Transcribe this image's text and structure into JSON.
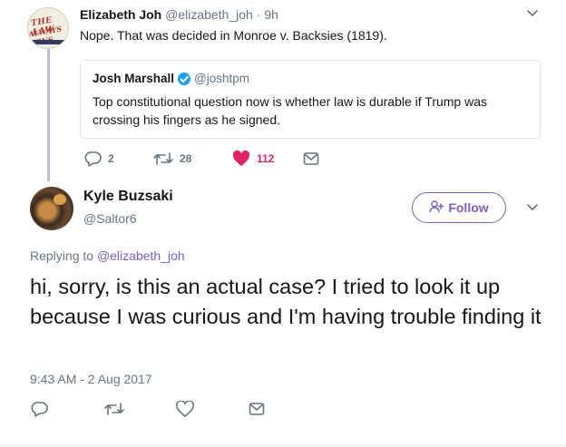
{
  "parent_tweet": {
    "avatar_text_line1": "THE LAW",
    "avatar_text_line2": "ALWAYS WINS",
    "author_name": "Elizabeth Joh",
    "author_handle": "@elizabeth_joh",
    "separator": "·",
    "time": "9h",
    "text": "Nope. That was decided in Monroe v. Backsies (1819).",
    "quoted": {
      "author_name": "Josh Marshall",
      "author_handle": "@joshtpm",
      "text": "Top constitutional question now is whether law is durable if Trump was crossing his fingers as he signed."
    },
    "actions": {
      "reply_count": "2",
      "retweet_count": "28",
      "like_count": "112"
    }
  },
  "main_tweet": {
    "author_name": "Kyle Buzsaki",
    "author_handle": "@Saltor6",
    "follow_label": "Follow",
    "replying_prefix": "Replying to",
    "replying_handle": "@elizabeth_joh",
    "text": "hi, sorry, is this an actual case? I tried to look it up because I was curious and I'm having trouble finding it",
    "timestamp": "9:43 AM - 2 Aug 2017"
  },
  "colors": {
    "accent": "#7e5dbe",
    "like": "#e0245e",
    "icon_gray": "#657786",
    "thread_line": "#c6b6e0"
  },
  "icons": [
    "reply-icon",
    "retweet-icon",
    "heart-icon",
    "message-icon",
    "chevron-down-icon",
    "add-person-icon"
  ]
}
